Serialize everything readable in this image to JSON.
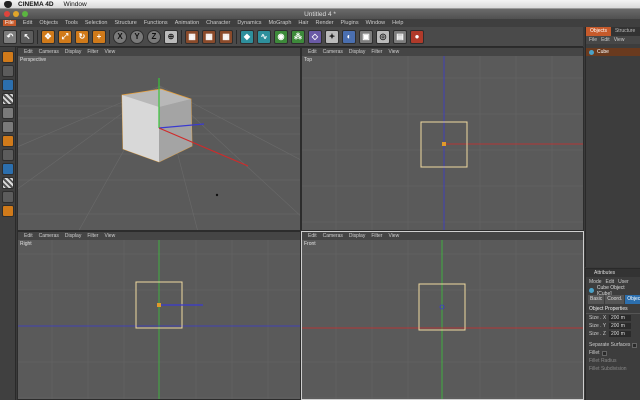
{
  "mac_menubar": {
    "app_name": "CINEMA 4D",
    "items": [
      "Window"
    ]
  },
  "window": {
    "title": "Untitled 4 *"
  },
  "c4d_menu": [
    "File",
    "Edit",
    "Objects",
    "Tools",
    "Selection",
    "Structure",
    "Functions",
    "Animation",
    "Character",
    "Dynamics",
    "MoGraph",
    "Hair",
    "Render",
    "Plugins",
    "Window",
    "Help"
  ],
  "toolbar_icons": [
    "undo-icon",
    "live-select-icon",
    "move-icon",
    "scale-icon",
    "rotate-icon",
    "move-tool-icon",
    "x-axis-icon",
    "y-axis-icon",
    "z-axis-icon",
    "world-coords-icon",
    "render-view-icon",
    "render-picture-viewer-icon",
    "render-settings-icon",
    "cube-primitive-icon",
    "spline-icon",
    "nurbs-icon",
    "array-icon",
    "deformer-icon",
    "scene-icon",
    "light-icon",
    "camera-icon",
    "tag-icon",
    "record-icon"
  ],
  "toolbar_letters": {
    "x": "X",
    "y": "Y",
    "z": "Z"
  },
  "viewport_menu": [
    "Edit",
    "Cameras",
    "Display",
    "Filter",
    "View"
  ],
  "viewports": {
    "perspective": {
      "label": "Perspective"
    },
    "top": {
      "label": "Top"
    },
    "right": {
      "label": "Right"
    },
    "front": {
      "label": "Front"
    }
  },
  "objects_panel": {
    "tabs": [
      "Objects",
      "Structure"
    ],
    "menu": [
      "File",
      "Edit",
      "View"
    ],
    "objects": [
      {
        "name": "Cube"
      }
    ]
  },
  "attributes_panel": {
    "title": "Attributes",
    "menu": [
      "Mode",
      "Edit",
      "User"
    ],
    "object_label": "Cube Object [Cube]",
    "tabs": [
      "Basic",
      "Coord.",
      "Object"
    ],
    "section": "Object Properties",
    "fields": [
      {
        "label": "Size . X",
        "value": "200 m"
      },
      {
        "label": "Size . Y",
        "value": "200 m"
      },
      {
        "label": "Size . Z",
        "value": "200 m"
      }
    ],
    "options": [
      "Separate Surfaces",
      "Fillet",
      "Fillet Radius",
      "Fillet Subdivision"
    ]
  },
  "colors": {
    "accent": "#c65a2b",
    "x_axis": "#d02a2a",
    "y_axis": "#3ac43a",
    "z_axis": "#3a3ad0",
    "selection": "#e09a2a"
  }
}
